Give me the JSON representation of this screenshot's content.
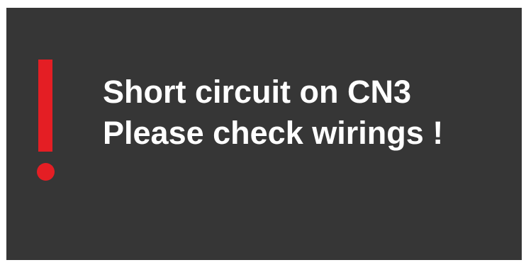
{
  "alert": {
    "line1": "Short circuit on CN3",
    "line2": "Please check wirings !",
    "icon": "exclamation-icon",
    "colors": {
      "background": "#363636",
      "text": "#ffffff",
      "icon": "#e41e24"
    }
  }
}
